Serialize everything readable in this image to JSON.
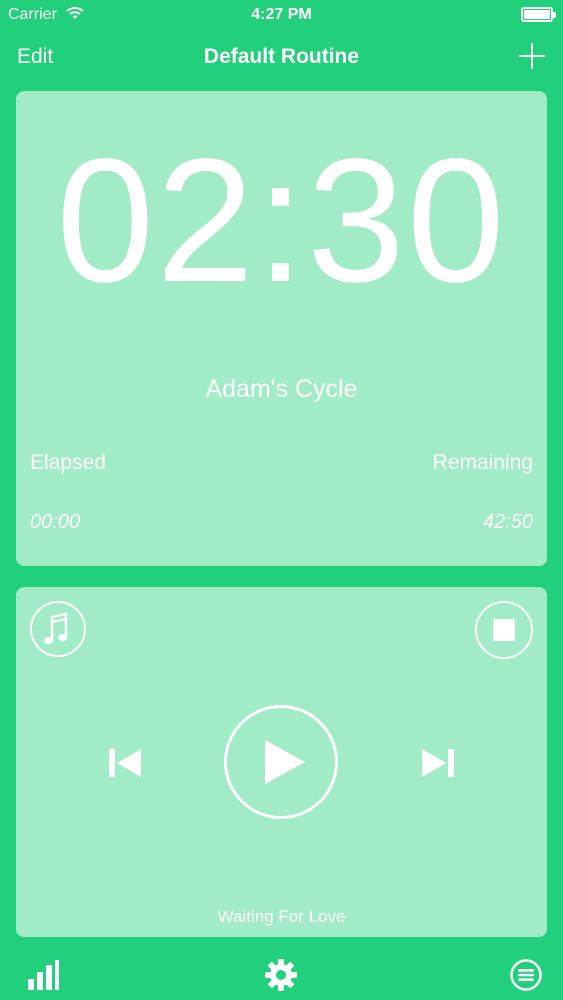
{
  "status_bar": {
    "carrier": "Carrier",
    "time": "4:27 PM",
    "icons": [
      "wifi-icon",
      "battery-icon"
    ]
  },
  "nav_bar": {
    "edit_label": "Edit",
    "title": "Default Routine",
    "add_icon": "plus-icon"
  },
  "timer": {
    "display": "02:30",
    "routine_name": "Adam's Cycle",
    "elapsed_label": "Elapsed",
    "remaining_label": "Remaining",
    "elapsed_value": "00:00",
    "remaining_value": "42:50"
  },
  "player": {
    "track_title": "Waiting For Love",
    "icons": [
      "music-note-icon",
      "stop-icon",
      "previous-icon",
      "play-icon",
      "next-icon"
    ]
  },
  "tab_bar": {
    "icons": [
      "bar-chart-icon",
      "gear-icon",
      "menu-list-icon"
    ]
  },
  "colors": {
    "background": "#22cf7a",
    "card": "#a6ecc9",
    "foreground": "#ffffff"
  }
}
